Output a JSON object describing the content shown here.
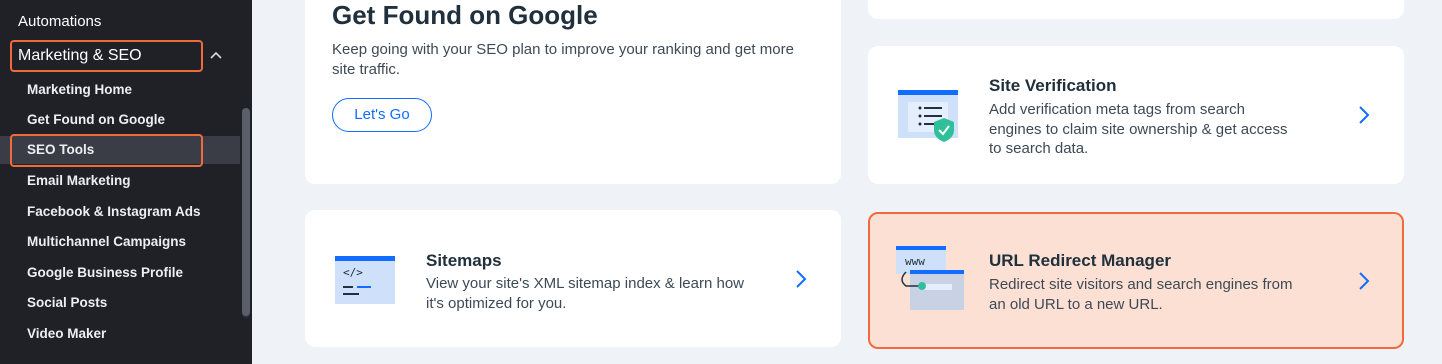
{
  "sidebar": {
    "top_item": "Automations",
    "section": "Marketing & SEO",
    "items": [
      "Marketing Home",
      "Get Found on Google",
      "SEO Tools",
      "Email Marketing",
      "Facebook & Instagram Ads",
      "Multichannel Campaigns",
      "Google Business Profile",
      "Social Posts",
      "Video Maker"
    ],
    "active_item": "SEO Tools"
  },
  "hero": {
    "title": "Get Found on Google",
    "description": "Keep going with your SEO plan to improve your ranking and get more site traffic.",
    "button": "Let's Go"
  },
  "tools": [
    {
      "title": "Site Verification",
      "description": "Add verification meta tags from search engines to claim site ownership & get access to search data.",
      "icon": "site-verification-icon"
    },
    {
      "title": "Sitemaps",
      "description": "View your site's XML sitemap index & learn how it's optimized for you.",
      "icon": "sitemap-code-icon",
      "icon_text": "</>"
    },
    {
      "title": "URL Redirect Manager",
      "description": "Redirect site visitors and search engines from an old URL to a new URL.",
      "icon": "url-redirect-icon",
      "icon_text": "www"
    }
  ],
  "colors": {
    "sidebar_bg": "#1f2127",
    "highlight": "#f06a3b",
    "highlight_bg": "#fde0d4",
    "accent": "#116dff",
    "page_bg": "#eff2f6"
  }
}
